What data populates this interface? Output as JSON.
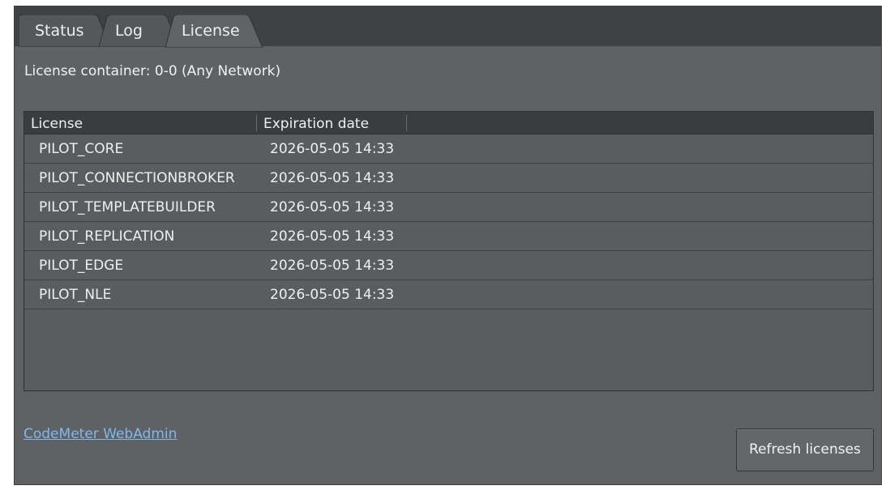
{
  "tabs": [
    {
      "label": "Status",
      "active": false
    },
    {
      "label": "Log",
      "active": false
    },
    {
      "label": "License",
      "active": true
    }
  ],
  "license_container": "License container: 0-0 (Any Network)",
  "table": {
    "columns": [
      "License",
      "Expiration date"
    ],
    "rows": [
      {
        "license": "PILOT_CORE",
        "expiration": "2026-05-05 14:33"
      },
      {
        "license": "PILOT_CONNECTIONBROKER",
        "expiration": "2026-05-05 14:33"
      },
      {
        "license": "PILOT_TEMPLATEBUILDER",
        "expiration": "2026-05-05 14:33"
      },
      {
        "license": "PILOT_REPLICATION",
        "expiration": "2026-05-05 14:33"
      },
      {
        "license": "PILOT_EDGE",
        "expiration": "2026-05-05 14:33"
      },
      {
        "license": "PILOT_NLE",
        "expiration": "2026-05-05 14:33"
      }
    ]
  },
  "webadmin_link": "CodeMeter WebAdmin",
  "refresh_button": "Refresh licenses",
  "colors": {
    "panel": "#5f6163",
    "tabbar": "#3f4143",
    "tab_inactive": "#55585a",
    "tab_active": "#606365",
    "link": "#7fb8f0"
  }
}
